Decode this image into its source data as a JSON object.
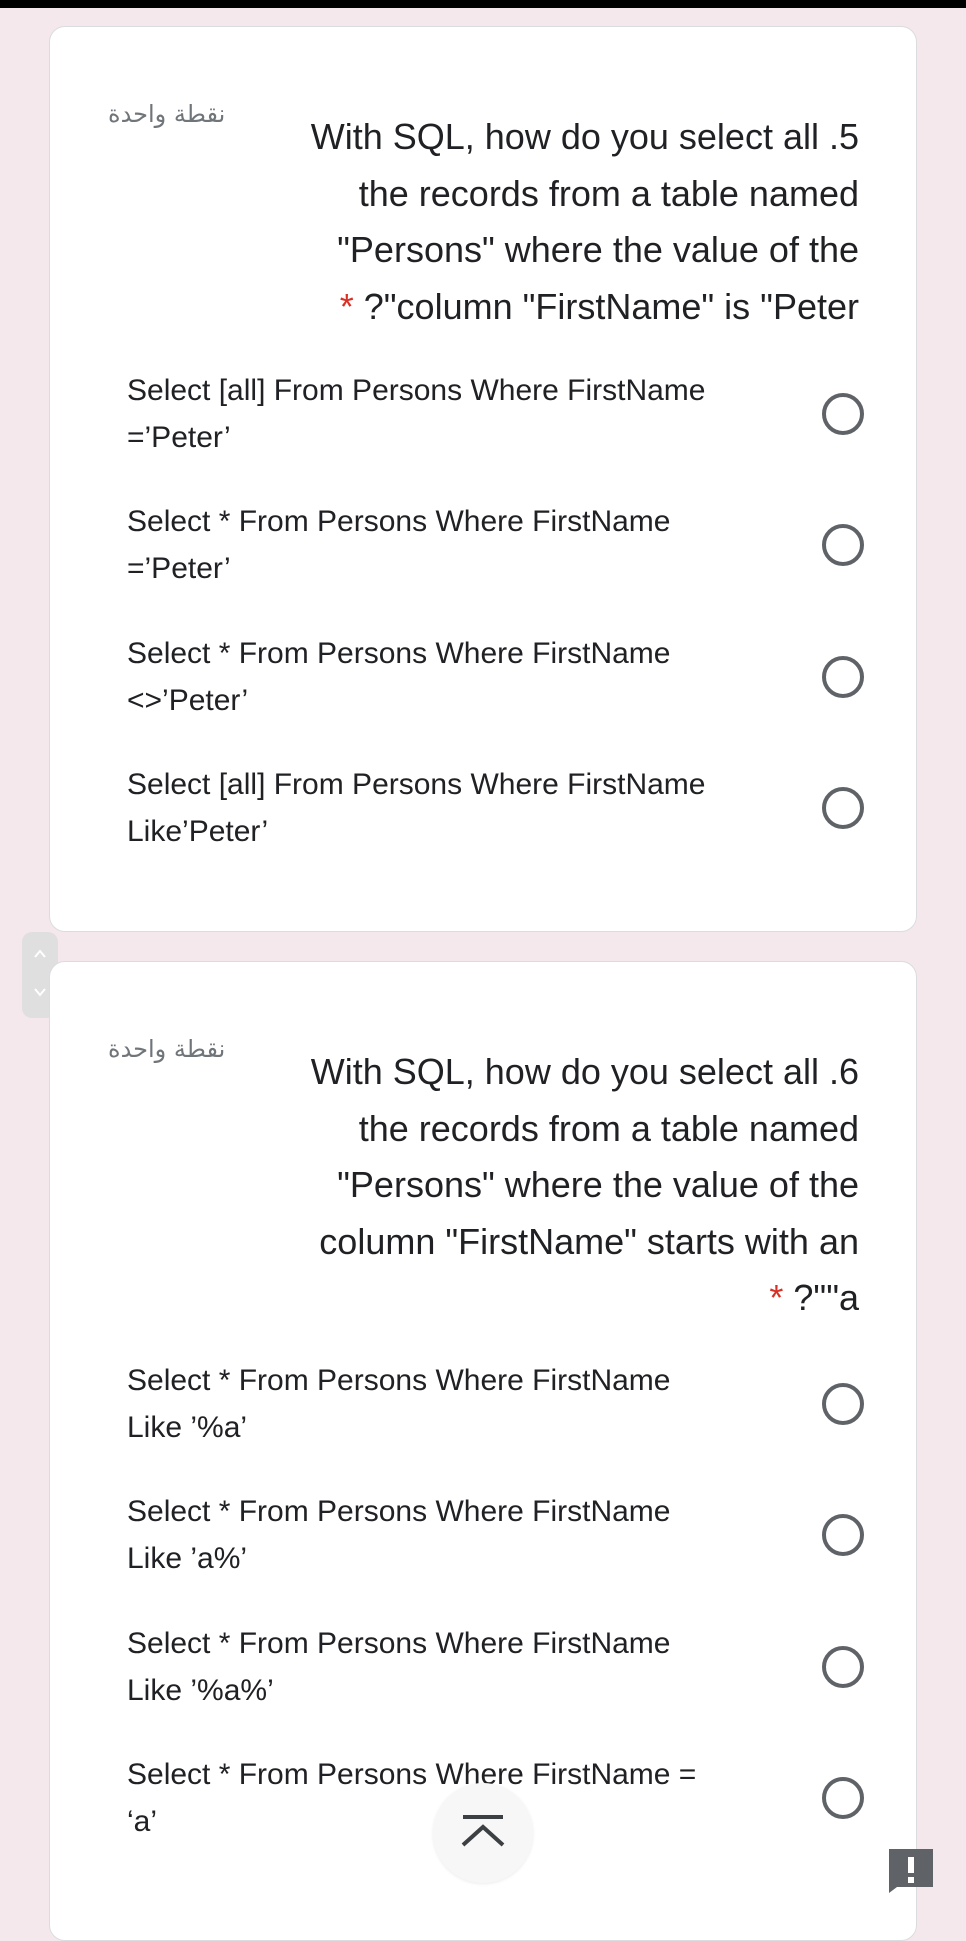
{
  "questions": [
    {
      "points": "نقطة واحدة",
      "lines": [
        "With SQL, how do you select all .5",
        "the records from a table named",
        "\"Persons\" where the value of the",
        "?\"column \"FirstName\" is \"Peter"
      ],
      "required_mark": "*",
      "options": [
        {
          "line1": "Select [all] From Persons Where FirstName",
          "line2": "=’Peter’"
        },
        {
          "line1": "Select * From Persons Where FirstName",
          "line2": "=’Peter’"
        },
        {
          "line1": "Select * From Persons Where FirstName",
          "line2": "<>’Peter’"
        },
        {
          "line1": "Select [all] From Persons Where FirstName",
          "line2": "Like’Peter’"
        }
      ]
    },
    {
      "points": "نقطة واحدة",
      "lines": [
        "With SQL, how do you select all .6",
        "the records from a table named",
        "\"Persons\" where the value of the",
        "column \"FirstName\" starts with an",
        "?\"\"a"
      ],
      "required_mark": "*",
      "options": [
        {
          "line1": "Select * From Persons Where FirstName",
          "line2": "Like ’%a’"
        },
        {
          "line1": "Select * From Persons Where FirstName",
          "line2": "Like ’a%’"
        },
        {
          "line1": "Select * From Persons Where FirstName",
          "line2": "Like ’%a%’"
        },
        {
          "line1": "Select * From Persons Where FirstName =",
          "line2": "‘a’"
        }
      ]
    }
  ],
  "icons": {
    "scroll_up": "chevron-up-icon",
    "scroll_down": "chevron-down-icon",
    "scroll_top": "scroll-to-top-icon",
    "report": "report-problem-icon"
  },
  "colors": {
    "background": "#f4e8ec",
    "required": "#d93025",
    "radio": "#5f6368"
  }
}
